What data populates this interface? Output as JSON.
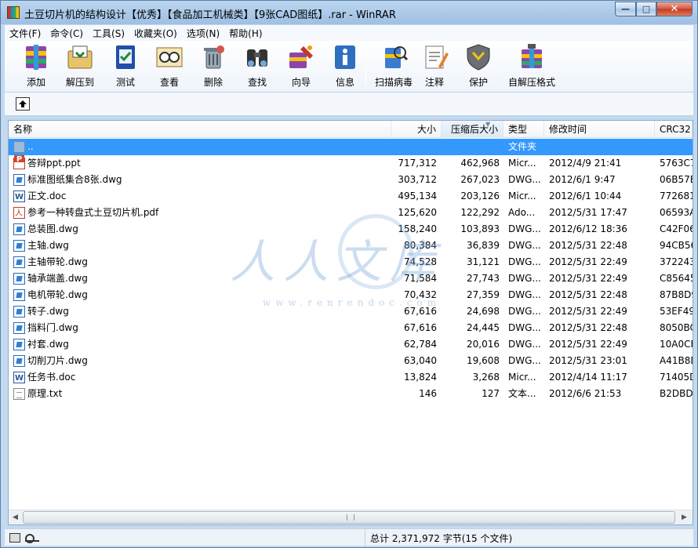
{
  "window": {
    "title": "土豆切片机的结构设计【优秀】【食品加工机械类】【9张CAD图纸】.rar - WinRAR",
    "minimize_glyph": "—",
    "maximize_glyph": "□",
    "close_glyph": "✕"
  },
  "menu": [
    {
      "label": "文件(F)"
    },
    {
      "label": "命令(C)"
    },
    {
      "label": "工具(S)"
    },
    {
      "label": "收藏夹(O)"
    },
    {
      "label": "选项(N)"
    },
    {
      "label": "帮助(H)"
    }
  ],
  "toolbar": [
    {
      "label": "添加",
      "icon": "add-archive-icon"
    },
    {
      "label": "解压到",
      "icon": "extract-to-icon"
    },
    {
      "label": "测试",
      "icon": "test-icon"
    },
    {
      "label": "查看",
      "icon": "view-icon"
    },
    {
      "label": "删除",
      "icon": "delete-icon"
    },
    {
      "label": "查找",
      "icon": "find-icon"
    },
    {
      "label": "向导",
      "icon": "wizard-icon"
    },
    {
      "label": "信息",
      "icon": "info-icon"
    },
    {
      "label": "扫描病毒",
      "icon": "virus-scan-icon"
    },
    {
      "label": "注释",
      "icon": "comment-icon"
    },
    {
      "label": "保护",
      "icon": "protect-icon"
    },
    {
      "label": "自解压格式",
      "icon": "sfx-icon"
    }
  ],
  "columns": {
    "name": "名称",
    "size": "大小",
    "packed": "压缩后大小",
    "type": "类型",
    "modified": "修改时间",
    "crc": "CRC32"
  },
  "files": [
    {
      "name": "..",
      "size": "",
      "packed": "",
      "type": "文件夹",
      "modified": "",
      "crc": "",
      "icon": "folder",
      "selected": true
    },
    {
      "name": "答辩ppt.ppt",
      "size": "717,312",
      "packed": "462,968",
      "type": "Micr...",
      "modified": "2012/4/9 21:41",
      "crc": "5763C7",
      "icon": "ppt"
    },
    {
      "name": "标准图纸集合8张.dwg",
      "size": "303,712",
      "packed": "267,023",
      "type": "DWG...",
      "modified": "2012/6/1 9:47",
      "crc": "06B57E",
      "icon": "dwg"
    },
    {
      "name": "正文.doc",
      "size": "495,134",
      "packed": "203,126",
      "type": "Micr...",
      "modified": "2012/6/1 10:44",
      "crc": "772681",
      "icon": "doc"
    },
    {
      "name": "参考一种转盘式土豆切片机.pdf",
      "size": "125,620",
      "packed": "122,292",
      "type": "Ado...",
      "modified": "2012/5/31 17:47",
      "crc": "06593A",
      "icon": "pdf"
    },
    {
      "name": "总装图.dwg",
      "size": "158,240",
      "packed": "103,893",
      "type": "DWG...",
      "modified": "2012/6/12 18:36",
      "crc": "C42F06",
      "icon": "dwg"
    },
    {
      "name": "主轴.dwg",
      "size": "80,384",
      "packed": "36,839",
      "type": "DWG...",
      "modified": "2012/5/31 22:48",
      "crc": "94CB56",
      "icon": "dwg"
    },
    {
      "name": "主轴带轮.dwg",
      "size": "74,528",
      "packed": "31,121",
      "type": "DWG...",
      "modified": "2012/5/31 22:49",
      "crc": "372243",
      "icon": "dwg"
    },
    {
      "name": "轴承端盖.dwg",
      "size": "71,584",
      "packed": "27,743",
      "type": "DWG...",
      "modified": "2012/5/31 22:49",
      "crc": "C85645",
      "icon": "dwg"
    },
    {
      "name": "电机带轮.dwg",
      "size": "70,432",
      "packed": "27,359",
      "type": "DWG...",
      "modified": "2012/5/31 22:48",
      "crc": "87B8D9",
      "icon": "dwg"
    },
    {
      "name": "转子.dwg",
      "size": "67,616",
      "packed": "24,698",
      "type": "DWG...",
      "modified": "2012/5/31 22:49",
      "crc": "53EF49",
      "icon": "dwg"
    },
    {
      "name": "挡料门.dwg",
      "size": "67,616",
      "packed": "24,445",
      "type": "DWG...",
      "modified": "2012/5/31 22:48",
      "crc": "8050BC",
      "icon": "dwg"
    },
    {
      "name": "衬套.dwg",
      "size": "62,784",
      "packed": "20,016",
      "type": "DWG...",
      "modified": "2012/5/31 22:49",
      "crc": "10A0CF",
      "icon": "dwg"
    },
    {
      "name": "切削刀片.dwg",
      "size": "63,040",
      "packed": "19,608",
      "type": "DWG...",
      "modified": "2012/5/31 23:01",
      "crc": "A41B8D",
      "icon": "dwg"
    },
    {
      "name": "任务书.doc",
      "size": "13,824",
      "packed": "3,268",
      "type": "Micr...",
      "modified": "2012/4/14 11:17",
      "crc": "71405D",
      "icon": "doc"
    },
    {
      "name": "原理.txt",
      "size": "146",
      "packed": "127",
      "type": "文本...",
      "modified": "2012/6/6 21:53",
      "crc": "B2DBD8",
      "icon": "txt"
    }
  ],
  "status": {
    "summary": "总计 2,371,972 字节(15 个文件)"
  },
  "watermark": {
    "text": "人人文库",
    "url": "www.renrendoc.com"
  }
}
